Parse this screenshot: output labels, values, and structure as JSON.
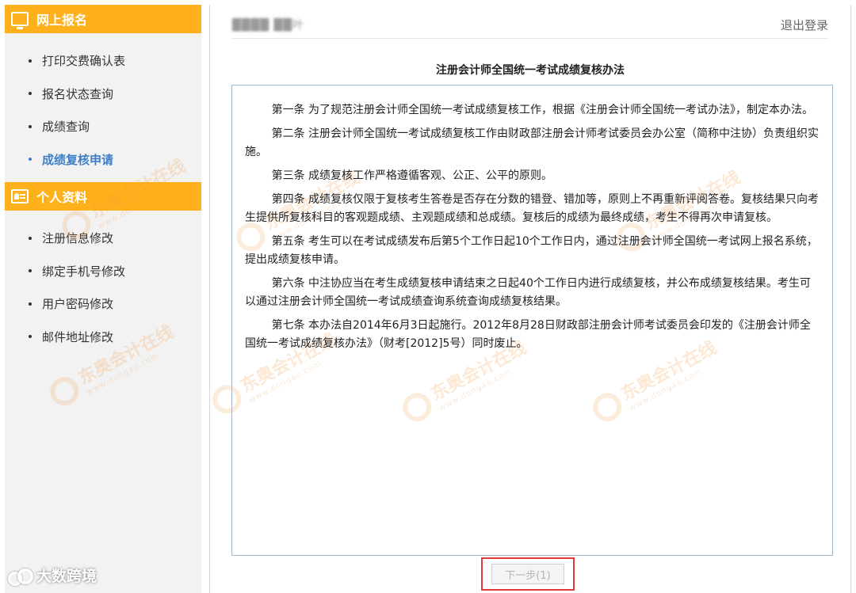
{
  "sidebar": {
    "sections": [
      {
        "title": "网上报名",
        "icon": "monitor-icon",
        "items": [
          {
            "label": "打印交费确认表"
          },
          {
            "label": "报名状态查询"
          },
          {
            "label": "成绩查询"
          },
          {
            "label": "成绩复核申请",
            "active": true
          }
        ]
      },
      {
        "title": "个人资料",
        "icon": "id-card-icon",
        "items": [
          {
            "label": "注册信息修改"
          },
          {
            "label": "绑定手机号修改"
          },
          {
            "label": "用户密码修改"
          },
          {
            "label": "邮件地址修改"
          }
        ]
      }
    ],
    "accent_color": "#ffb11b",
    "active_color": "#3d7fc6"
  },
  "header": {
    "user_name": "████ ██叶",
    "logout_label": "退出登录"
  },
  "document": {
    "title": "注册会计师全国统一考试成绩复核办法",
    "paragraphs": [
      "第一条 为了规范注册会计师全国统一考试成绩复核工作，根据《注册会计师全国统一考试办法》，制定本办法。",
      "第二条 注册会计师全国统一考试成绩复核工作由财政部注册会计师考试委员会办公室（简称中注协）负责组织实施。",
      "第三条 成绩复核工作严格遵循客观、公正、公平的原则。",
      "第四条 成绩复核仅限于复核考生答卷是否存在分数的错登、错加等，原则上不再重新评阅答卷。复核结果只向考生提供所复核科目的客观题成绩、主观题成绩和总成绩。复核后的成绩为最终成绩，考生不得再次申请复核。",
      "第五条 考生可以在考试成绩发布后第5个工作日起10个工作日内，通过注册会计师全国统一考试网上报名系统，提出成绩复核申请。",
      "第六条 中注协应当在考生成绩复核申请结束之日起40个工作日内进行成绩复核，并公布成绩复核结果。考生可以通过注册会计师全国统一考试成绩查询系统查询成绩复核结果。",
      "第七条 本办法自2014年6月3日起施行。2012年8月28日财政部注册会计师考试委员会印发的《注册会计师全国统一考试成绩复核办法》（财考[2012]5号）同时废止。"
    ]
  },
  "footer": {
    "next_button_label": "下一步(1)"
  },
  "watermark": {
    "text": "东奥会计在线",
    "url": "www.dongao.com"
  },
  "channel_mark": {
    "text": "大数跨境"
  }
}
